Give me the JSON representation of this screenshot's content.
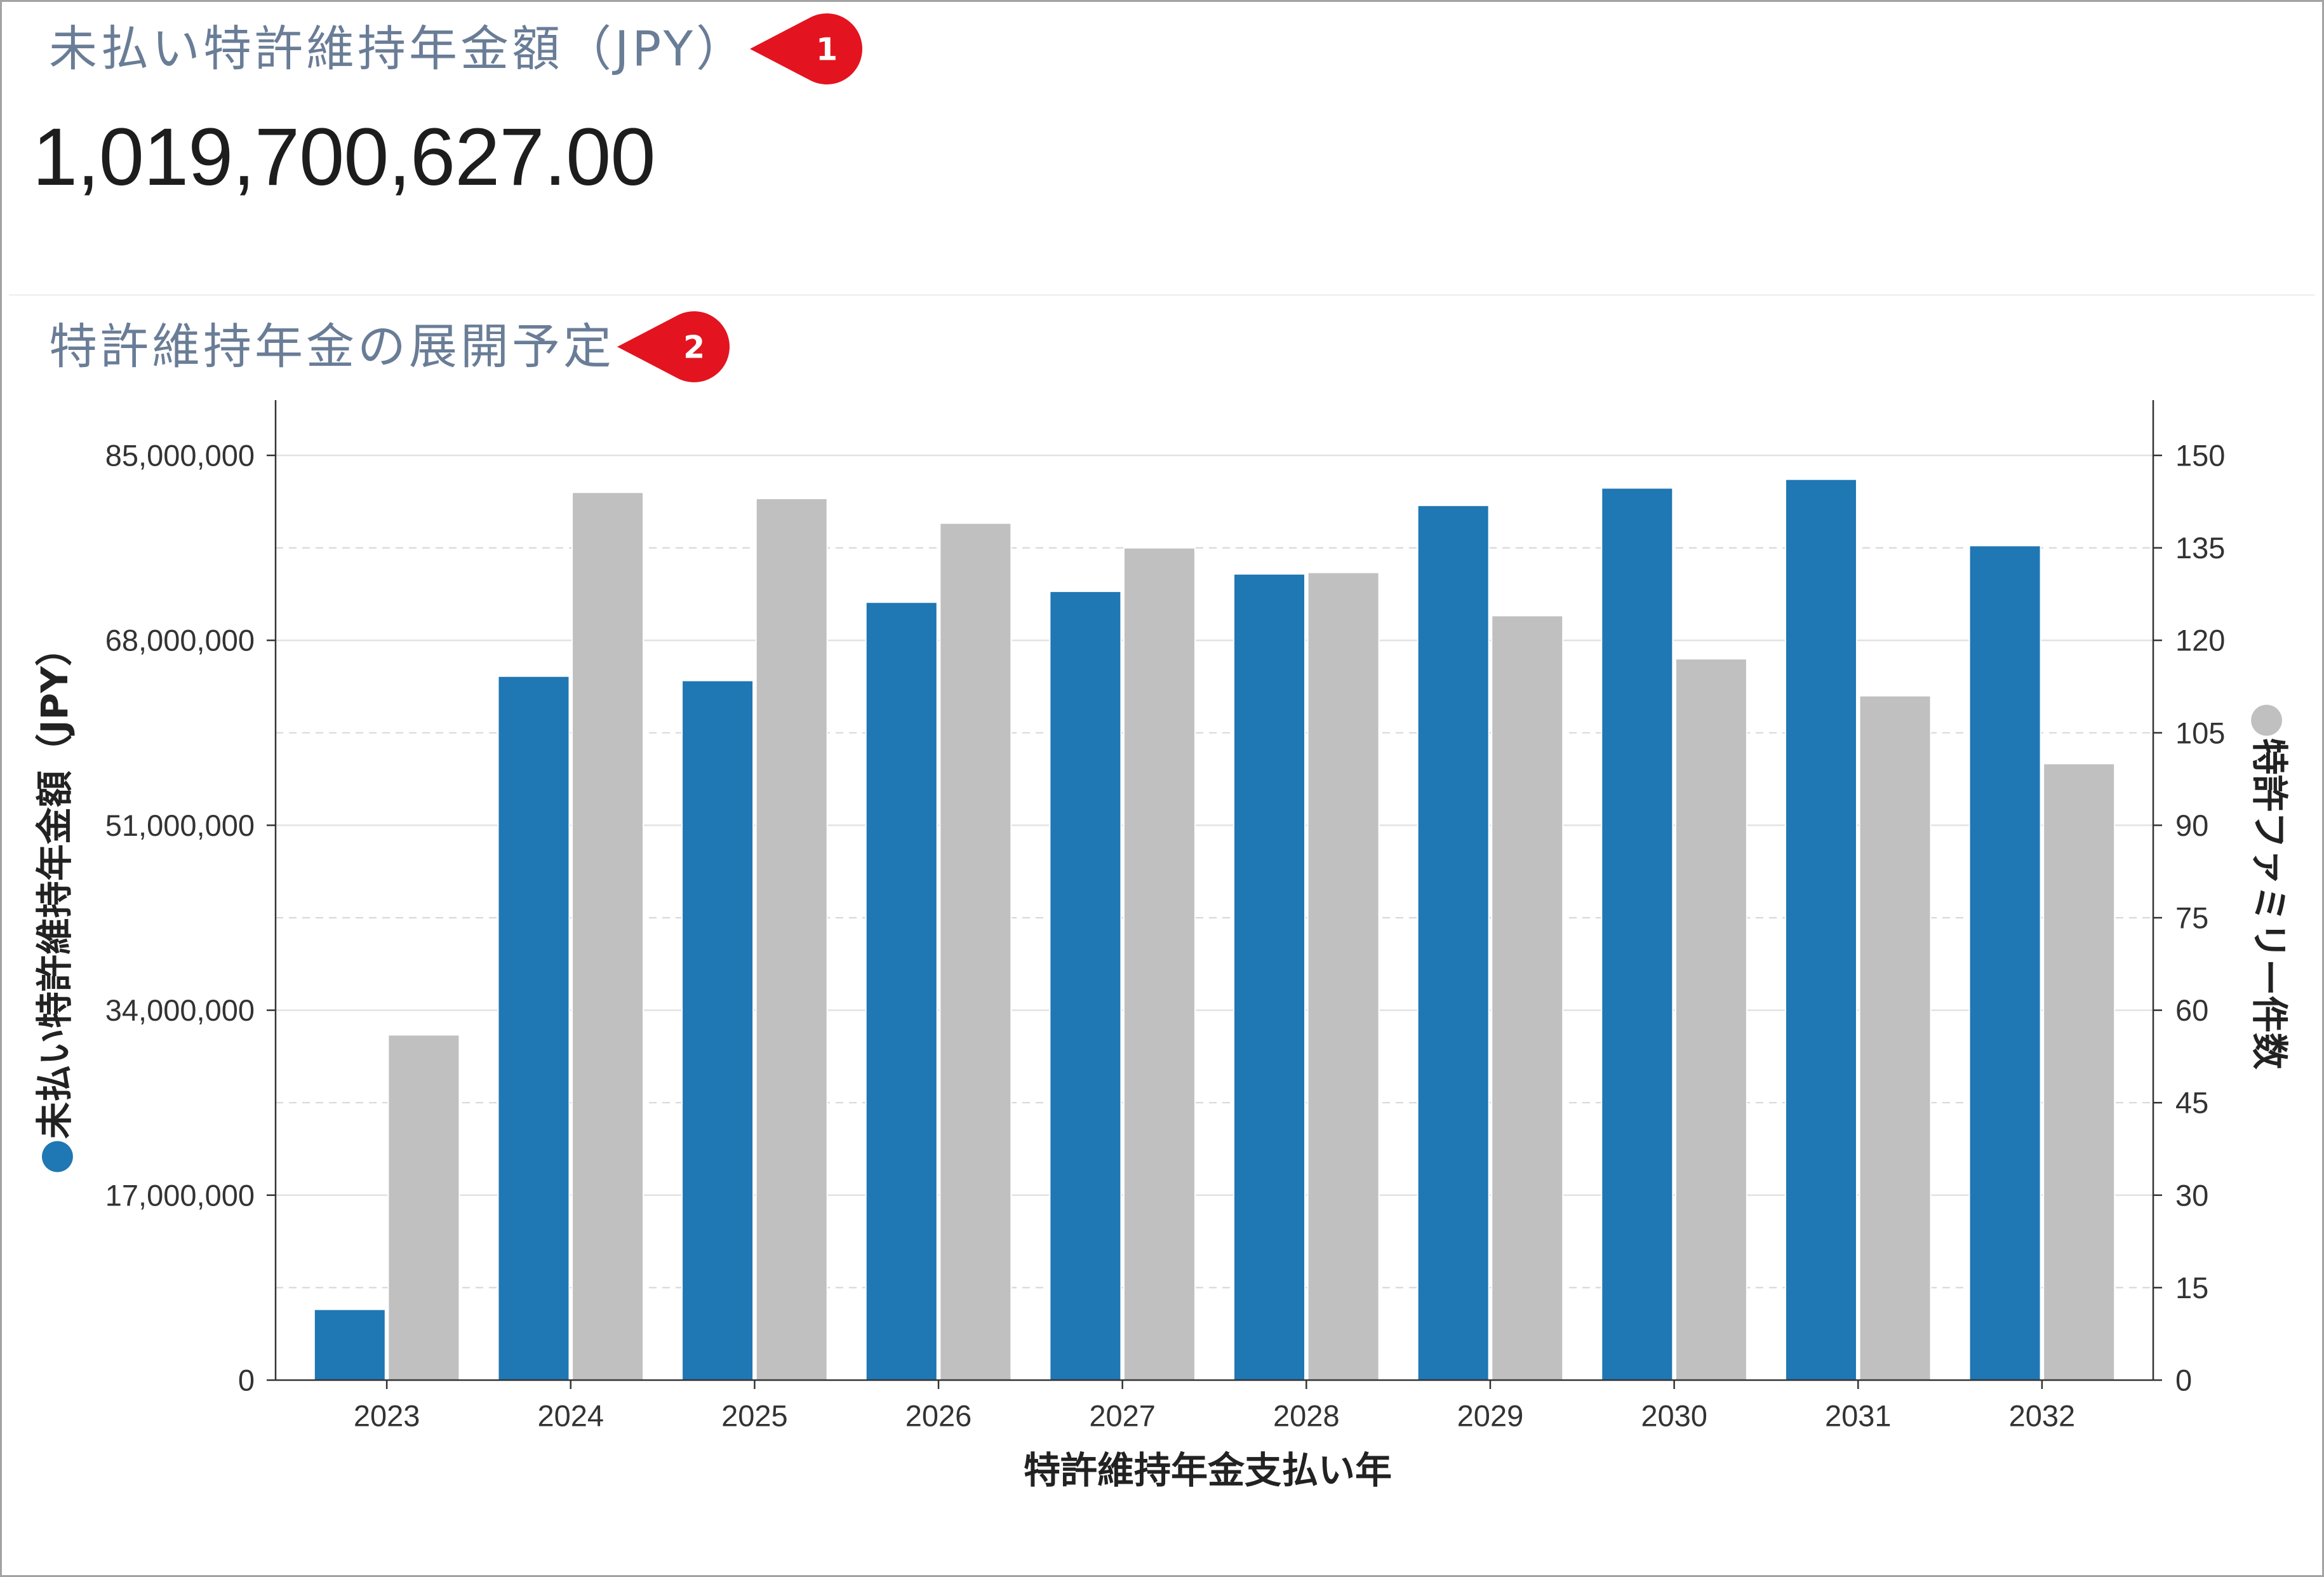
{
  "colors": {
    "section_title": "#6a7d97"
  },
  "kpi": {
    "title": "未払い特許維持年金額（JPY）",
    "value": "1,019,700,627.00"
  },
  "badges": [
    {
      "label": "1",
      "color": "#e3141f"
    },
    {
      "label": "2",
      "color": "#e3141f"
    }
  ],
  "chart_data": {
    "type": "bar",
    "title": "特許維持年金の展開予定",
    "categories": [
      "2023",
      "2024",
      "2025",
      "2026",
      "2027",
      "2028",
      "2029",
      "2030",
      "2031",
      "2032"
    ],
    "xlabel": "特許維持年金支払い年",
    "ylabel": "未払い特許維持年金額（JPY）",
    "y2label": "特許ファミリー件数",
    "ylim": [
      0,
      85000000
    ],
    "y2lim": [
      0,
      150
    ],
    "yticks": [
      "0",
      "17,000,000",
      "34,000,000",
      "51,000,000",
      "68,000,000",
      "85,000,000"
    ],
    "y2ticks": [
      "0",
      "15",
      "30",
      "45",
      "60",
      "75",
      "90",
      "105",
      "120",
      "135",
      "150"
    ],
    "grid": true,
    "series": [
      {
        "color": "#1f77b4",
        "secondary_axis": false,
        "values": [
          6500000,
          64700000,
          64300000,
          71500000,
          72500000,
          74100000,
          80400000,
          82000000,
          82800000,
          76700000
        ]
      },
      {
        "color": "#c0c0c0",
        "secondary_axis": true,
        "values": [
          56,
          144,
          143,
          139,
          135,
          131,
          124,
          117,
          111,
          100
        ]
      }
    ]
  }
}
